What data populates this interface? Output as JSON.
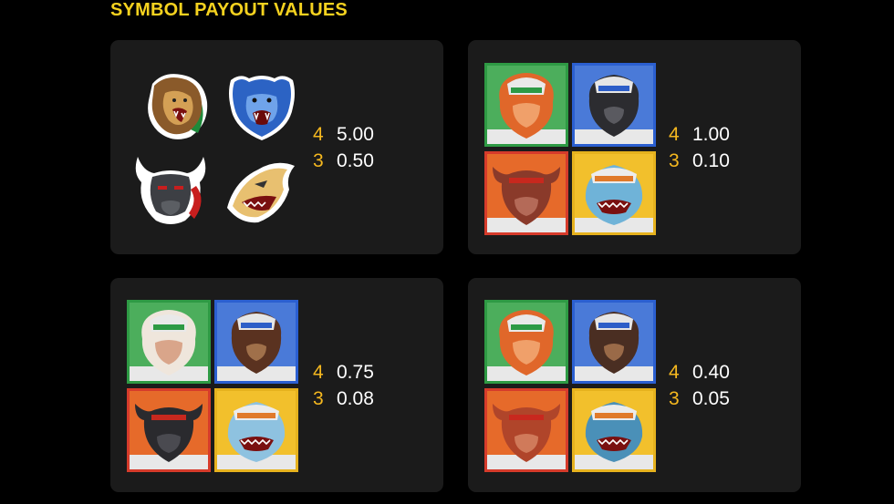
{
  "title": "SYMBOL PAYOUT VALUES",
  "colors": {
    "accent": "#f5d21f",
    "count": "#f5b81f",
    "panel": "#1b1b1b"
  },
  "panels": [
    {
      "type": "logos",
      "symbols": [
        "lion-logo",
        "bear-logo",
        "bull-logo",
        "shark-logo"
      ],
      "payouts": [
        {
          "count": "4",
          "value": "5.00"
        },
        {
          "count": "3",
          "value": "0.50"
        }
      ]
    },
    {
      "type": "tiles",
      "symbols": [
        "lion",
        "bear",
        "bull",
        "shark"
      ],
      "payouts": [
        {
          "count": "4",
          "value": "1.00"
        },
        {
          "count": "3",
          "value": "0.10"
        }
      ]
    },
    {
      "type": "tiles",
      "symbols": [
        "lion",
        "bear",
        "bull",
        "shark"
      ],
      "payouts": [
        {
          "count": "4",
          "value": "0.75"
        },
        {
          "count": "3",
          "value": "0.08"
        }
      ]
    },
    {
      "type": "tiles",
      "symbols": [
        "lion",
        "bear",
        "bull",
        "shark"
      ],
      "payouts": [
        {
          "count": "4",
          "value": "0.40"
        },
        {
          "count": "3",
          "value": "0.05"
        }
      ]
    }
  ]
}
